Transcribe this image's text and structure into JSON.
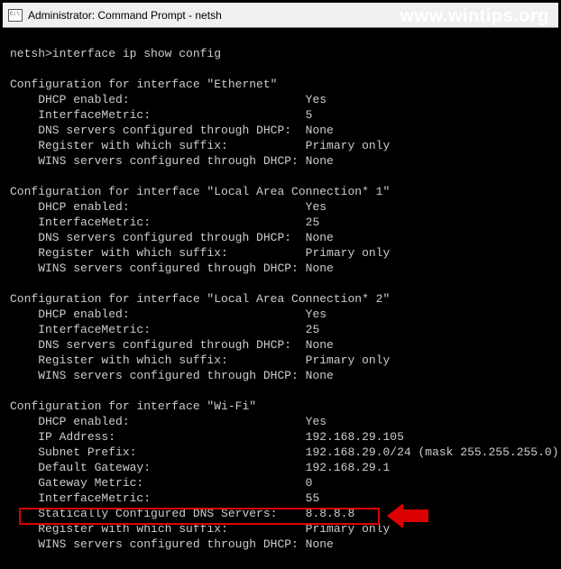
{
  "titlebar": {
    "title": "Administrator: Command Prompt - netsh"
  },
  "watermark": "www.wintips.org",
  "prompt": "netsh>",
  "command": "interface ip show config",
  "interfaces": [
    {
      "header": "Configuration for interface \"Ethernet\"",
      "rows": [
        {
          "k": "DHCP enabled:",
          "v": "Yes"
        },
        {
          "k": "InterfaceMetric:",
          "v": "5"
        },
        {
          "k": "DNS servers configured through DHCP:",
          "v": "None"
        },
        {
          "k": "Register with which suffix:",
          "v": "Primary only"
        },
        {
          "k": "WINS servers configured through DHCP:",
          "v": "None"
        }
      ]
    },
    {
      "header": "Configuration for interface \"Local Area Connection* 1\"",
      "rows": [
        {
          "k": "DHCP enabled:",
          "v": "Yes"
        },
        {
          "k": "InterfaceMetric:",
          "v": "25"
        },
        {
          "k": "DNS servers configured through DHCP:",
          "v": "None"
        },
        {
          "k": "Register with which suffix:",
          "v": "Primary only"
        },
        {
          "k": "WINS servers configured through DHCP:",
          "v": "None"
        }
      ]
    },
    {
      "header": "Configuration for interface \"Local Area Connection* 2\"",
      "rows": [
        {
          "k": "DHCP enabled:",
          "v": "Yes"
        },
        {
          "k": "InterfaceMetric:",
          "v": "25"
        },
        {
          "k": "DNS servers configured through DHCP:",
          "v": "None"
        },
        {
          "k": "Register with which suffix:",
          "v": "Primary only"
        },
        {
          "k": "WINS servers configured through DHCP:",
          "v": "None"
        }
      ]
    },
    {
      "header": "Configuration for interface \"Wi-Fi\"",
      "rows": [
        {
          "k": "DHCP enabled:",
          "v": "Yes"
        },
        {
          "k": "IP Address:",
          "v": "192.168.29.105"
        },
        {
          "k": "Subnet Prefix:",
          "v": "192.168.29.0/24 (mask 255.255.255.0)"
        },
        {
          "k": "Default Gateway:",
          "v": "192.168.29.1"
        },
        {
          "k": "Gateway Metric:",
          "v": "0"
        },
        {
          "k": "InterfaceMetric:",
          "v": "55"
        },
        {
          "k": "Statically Configured DNS Servers:",
          "v": "8.8.8.8"
        },
        {
          "k": "Register with which suffix:",
          "v": "Primary only"
        },
        {
          "k": "WINS servers configured through DHCP:",
          "v": "None"
        }
      ]
    }
  ],
  "highlight": {
    "interface_index": 3,
    "row_index": 6
  }
}
